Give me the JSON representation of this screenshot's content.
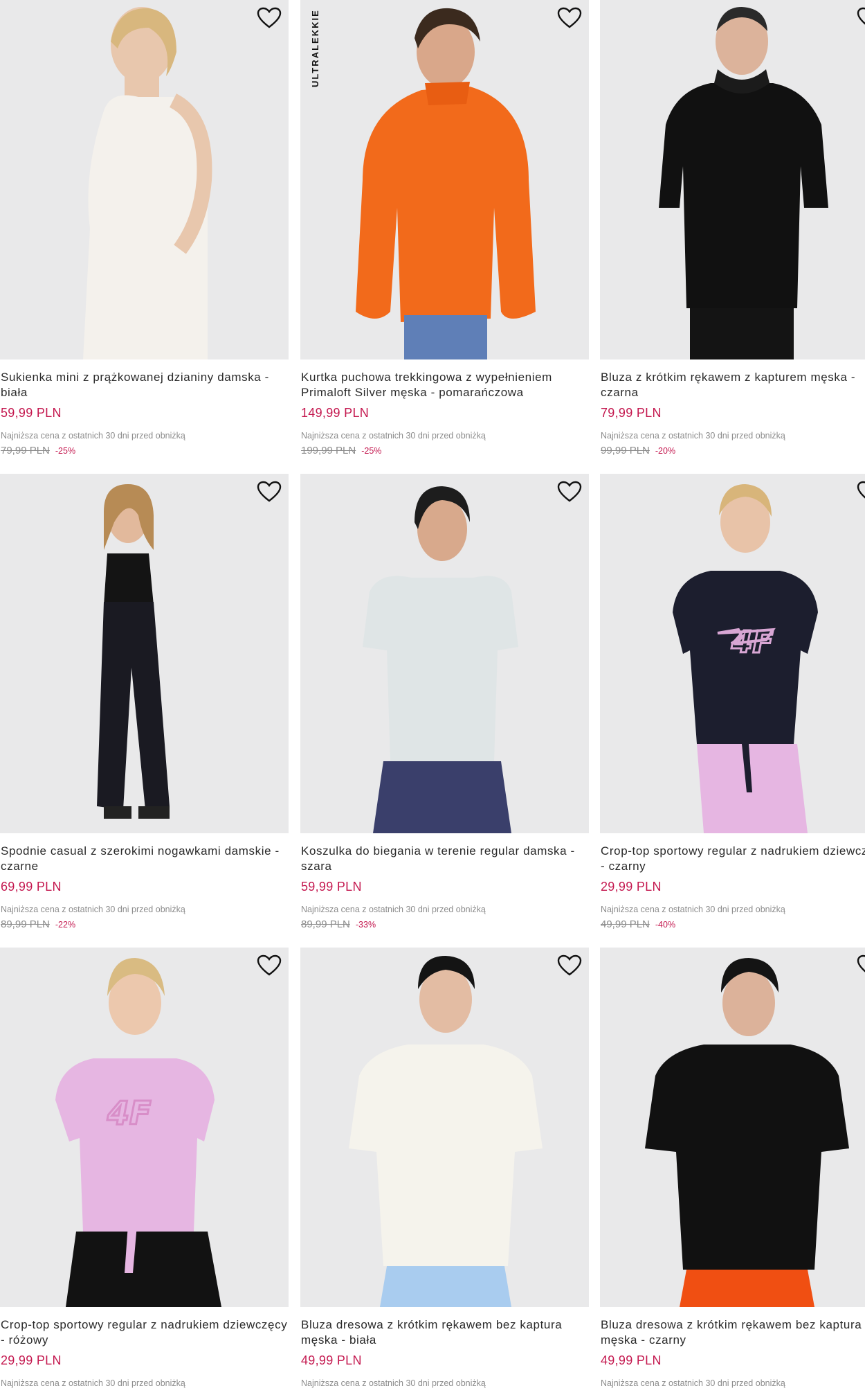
{
  "products": [
    {
      "name": "Sukienka mini z prążkowanej dzianiny damska - biała",
      "price": "59,99 PLN",
      "lowest_label": "Najniższa cena z ostatnich 30 dni przed obniżką",
      "old_price": "79,99 PLN",
      "discount": "-25%",
      "badge": ""
    },
    {
      "name": "Kurtka puchowa trekkingowa z wypełnieniem Primaloft Silver męska - pomarańczowa",
      "price": "149,99 PLN",
      "lowest_label": "Najniższa cena z ostatnich 30 dni przed obniżką",
      "old_price": "199,99 PLN",
      "discount": "-25%",
      "badge": "ULTRALEKKIE"
    },
    {
      "name": "Bluza z krótkim rękawem z kapturem męska - czarna",
      "price": "79,99 PLN",
      "lowest_label": "Najniższa cena z ostatnich 30 dni przed obniżką",
      "old_price": "99,99 PLN",
      "discount": "-20%",
      "badge": ""
    },
    {
      "name": "Spodnie casual z szerokimi nogawkami damskie - czarne",
      "price": "69,99 PLN",
      "lowest_label": "Najniższa cena z ostatnich 30 dni przed obniżką",
      "old_price": "89,99 PLN",
      "discount": "-22%",
      "badge": ""
    },
    {
      "name": "Koszulka do biegania w terenie regular damska - szara",
      "price": "59,99 PLN",
      "lowest_label": "Najniższa cena z ostatnich 30 dni przed obniżką",
      "old_price": "89,99 PLN",
      "discount": "-33%",
      "badge": ""
    },
    {
      "name": "Crop-top sportowy regular z nadrukiem dziewczęcy - czarny",
      "price": "29,99 PLN",
      "lowest_label": "Najniższa cena z ostatnich 30 dni przed obniżką",
      "old_price": "49,99 PLN",
      "discount": "-40%",
      "badge": ""
    },
    {
      "name": "Crop-top sportowy regular z nadrukiem dziewczęcy - różowy",
      "price": "29,99 PLN",
      "lowest_label": "Najniższa cena z ostatnich 30 dni przed obniżką",
      "old_price": "",
      "discount": "",
      "badge": ""
    },
    {
      "name": "Bluza dresowa z krótkim rękawem bez kaptura męska - biała",
      "price": "49,99 PLN",
      "lowest_label": "Najniższa cena z ostatnich 30 dni przed obniżką",
      "old_price": "",
      "discount": "",
      "badge": ""
    },
    {
      "name": "Bluza dresowa z krótkim rękawem bez kaptura męska - czarny",
      "price": "49,99 PLN",
      "lowest_label": "Najniższa cena z ostatnich 30 dni przed obniżką",
      "old_price": "",
      "discount": "",
      "badge": ""
    }
  ],
  "icons": {
    "favorite": "heart-outline-icon"
  },
  "colors": {
    "price": "#c4184f",
    "muted": "#8c8c8c",
    "image_bg": "#e7e7e8",
    "orange_jacket": "#f26a1b",
    "pink_top": "#e6b6e2",
    "light_blue": "#a9ccef"
  }
}
